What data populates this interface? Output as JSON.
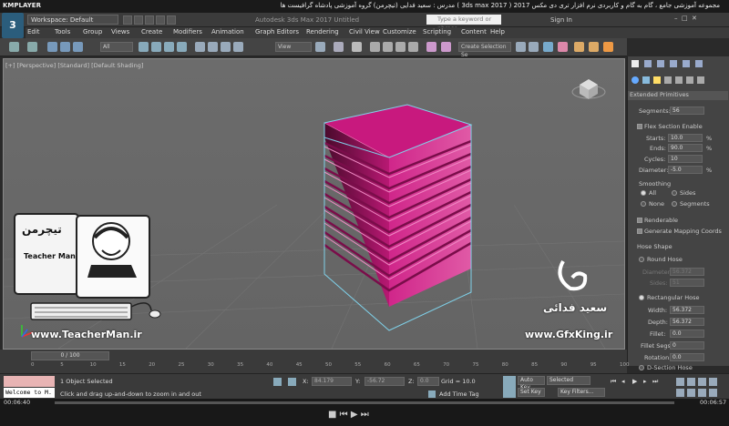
{
  "player": {
    "logo": "KMPLAYER",
    "title": "مجموعه آموزشی جامع ، گام به گام و کاربردی نرم افزار تری دی مکس 2017 ( 3ds max 2017 ) مدرس : سعید فدایی (تیچرمن) گروه آموزشی پادشاه گرافیست ها",
    "time_left": "00:06:40",
    "time_right": "00:06:57"
  },
  "app": {
    "logo": "3",
    "logo_sub": "MAX",
    "workspace": "Workspace: Default",
    "window_title": "Autodesk 3ds Max 2017   Untitled",
    "search_placeholder": "Type a keyword or phrase",
    "signin": "Sign In"
  },
  "menu": [
    "Edit",
    "Tools",
    "Group",
    "Views",
    "Create",
    "Modifiers",
    "Animation",
    "Graph Editors",
    "Rendering",
    "Civil View",
    "Customize",
    "Scripting",
    "Content",
    "Help"
  ],
  "toolbar": {
    "filter": "All",
    "ref_coord": "View",
    "selection_set": "Create Selection Se"
  },
  "viewport": {
    "label": "[+] [Perspective] [Standard] [Default Shading]",
    "watermark_name": "سعید فدائی",
    "watermark_url": "www.GfxKing.ir",
    "teacher_url": "www.TeacherMan.ir",
    "teacher_name": "Teacher Man",
    "teacher_logo": "تیچرمن"
  },
  "command_panel": {
    "category": "Extended Primitives",
    "segments_label": "Segments:",
    "segments": "56",
    "flex_section": "Flex Section Enable",
    "starts_label": "Starts:",
    "starts": "10.0",
    "ends_label": "Ends:",
    "ends": "90.0",
    "cycles_label": "Cycles:",
    "cycles": "10",
    "diameter_label": "Diameter:",
    "diameter": "-5.0",
    "percent": "%",
    "smoothing_label": "Smoothing",
    "smooth_all": "All",
    "smooth_sides": "Sides",
    "smooth_none": "None",
    "smooth_segments": "Segments",
    "renderable": "Renderable",
    "gen_mapping": "Generate Mapping Coords",
    "hose_shape": "Hose Shape",
    "round_hose": "Round Hose",
    "round_diameter_label": "Diameter:",
    "round_diameter": "56.372",
    "sides_label": "Sides:",
    "sides": "51",
    "rect_hose": "Rectangular Hose",
    "width_label": "Width:",
    "width": "56.372",
    "depth_label": "Depth:",
    "depth": "56.372",
    "fillet_label": "Fillet:",
    "fillet": "0.0",
    "fillet_segs_label": "Fillet Segs:",
    "fillet_segs": "0",
    "rotation_label": "Rotation:",
    "rotation": "0.0",
    "dsection": "D-Section Hose"
  },
  "timeline": {
    "frame": "0 / 100",
    "ticks": [
      "0",
      "5",
      "10",
      "15",
      "20",
      "25",
      "30",
      "35",
      "40",
      "45",
      "50",
      "55",
      "60",
      "65",
      "70",
      "75",
      "80",
      "85",
      "90",
      "95",
      "100"
    ]
  },
  "status": {
    "selected": "1 Object Selected",
    "prompt": "Click and drag up-and-down to zoom in and out",
    "x_label": "X:",
    "x": "84.179",
    "y_label": "Y:",
    "y": "-56.72",
    "z_label": "Z:",
    "z": "0.0",
    "grid": "Grid = 10.0",
    "add_time_tag": "Add Time Tag",
    "auto_key": "Auto Key",
    "selected_mode": "Selected",
    "set_key": "Set Key",
    "key_filters": "Key Filters...",
    "welcome": "Welcome to M."
  },
  "colors": {
    "object": "#c8197e",
    "selection": "#7fd0e8",
    "viewport_bg": "#6a6a6a"
  }
}
